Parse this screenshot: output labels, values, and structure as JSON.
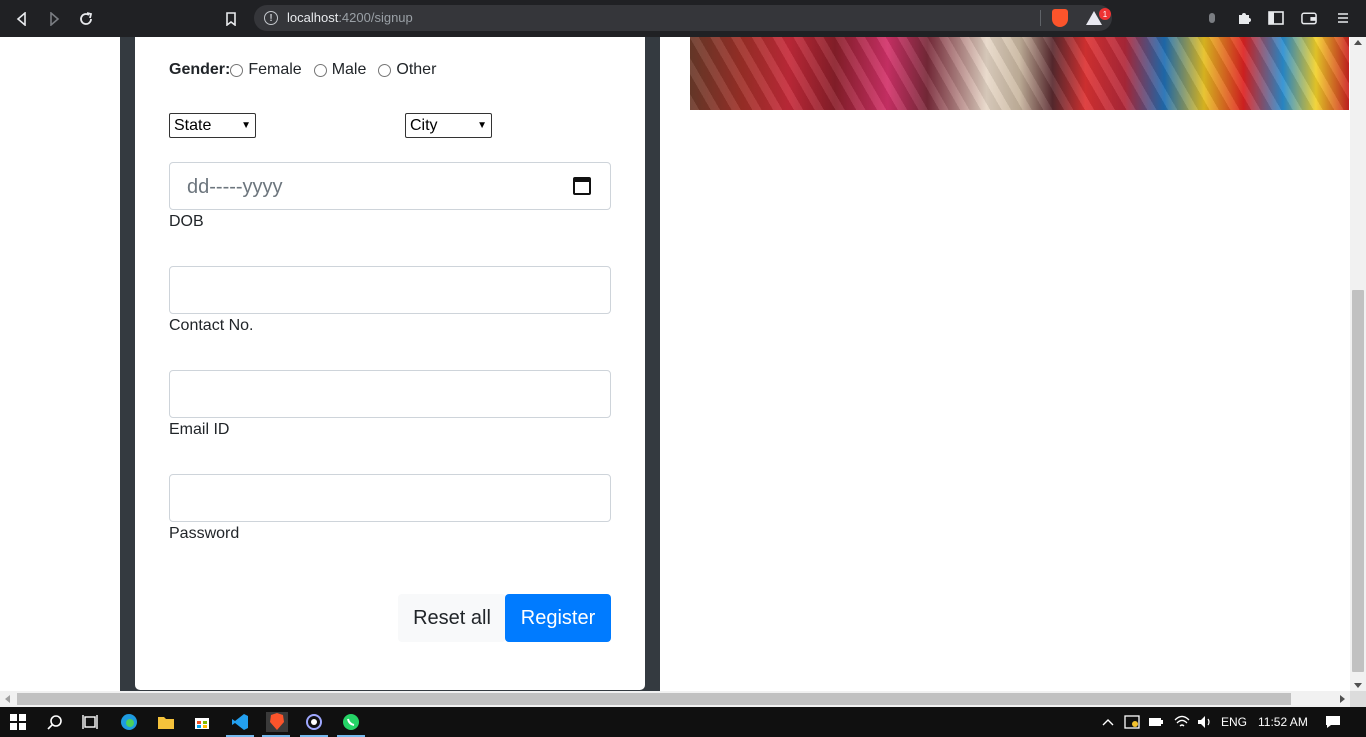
{
  "browser": {
    "url_host": "localhost",
    "url_path": ":4200/signup",
    "rewards_count": "1"
  },
  "form": {
    "gender_label": "Gender:",
    "gender_options": [
      "Female",
      "Male",
      "Other"
    ],
    "state_select": "State",
    "city_select": "City",
    "dob_placeholder": "dd-----yyyy",
    "dob_label": "DOB",
    "contact_label": "Contact No.",
    "email_label": "Email ID",
    "password_label": "Password",
    "reset_button": "Reset all",
    "register_button": "Register"
  },
  "taskbar": {
    "language": "ENG",
    "time": "11:52 AM"
  },
  "colors": {
    "primary": "#007bff",
    "frame_dark": "#343a40",
    "browser_bar": "#202124"
  }
}
